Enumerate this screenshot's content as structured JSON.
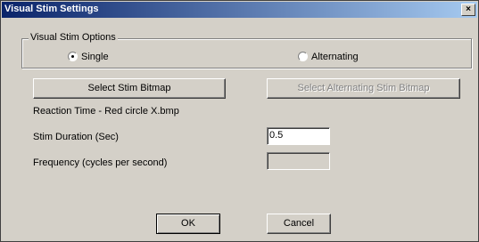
{
  "window": {
    "title": "Visual Stim Settings",
    "close_label": "×"
  },
  "options": {
    "group_label": "Visual Stim Options",
    "single_label": "Single",
    "alternating_label": "Alternating",
    "selected": "Single"
  },
  "buttons": {
    "select_stim": "Select Stim Bitmap",
    "select_alt_stim": "Select Alternating Stim Bitmap",
    "ok": "OK",
    "cancel": "Cancel"
  },
  "bitmap_name": "Reaction Time - Red circle X.bmp",
  "duration": {
    "label": "Stim Duration (Sec)",
    "value": "0.5"
  },
  "frequency": {
    "label": "Frequency (cycles per second)",
    "value": ""
  }
}
